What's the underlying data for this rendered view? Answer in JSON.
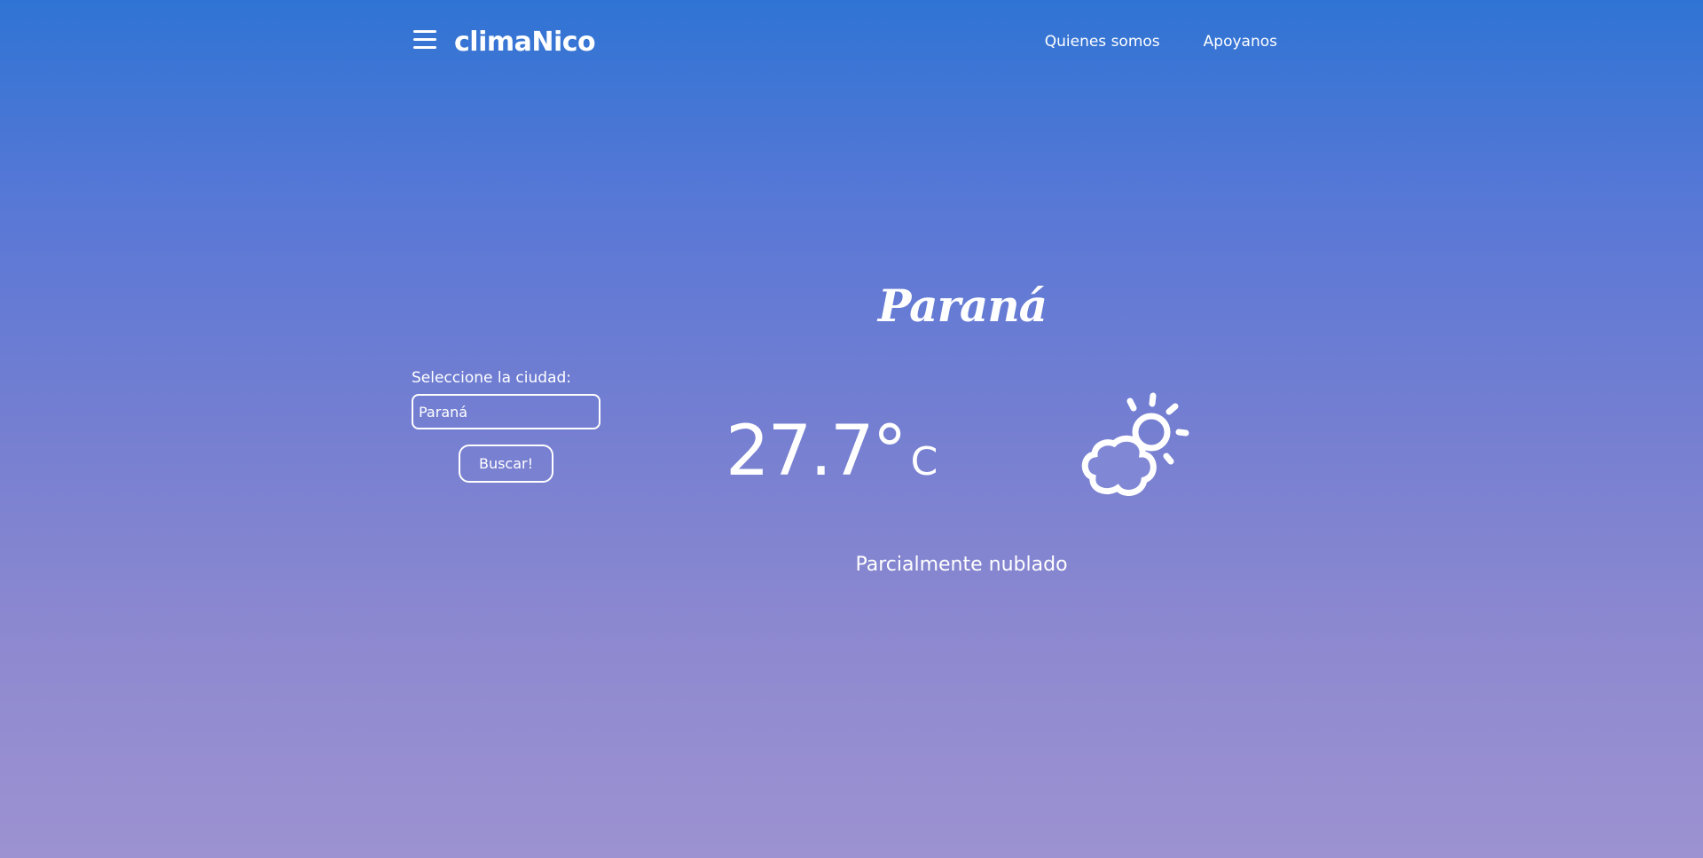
{
  "app": {
    "brand": "climaNico",
    "nav": [
      {
        "label": "Quienes somos"
      },
      {
        "label": "Apoyanos"
      }
    ],
    "menu_icon": "hamburger-icon"
  },
  "search": {
    "label": "Seleccione la ciudad:",
    "value": "Paraná",
    "button_label": "Buscar!"
  },
  "weather": {
    "city": "Paraná",
    "temperature": "27.7°",
    "unit": "C",
    "condition": "Parcialmente nublado",
    "icon": "partly-cloudy-icon"
  },
  "colors": {
    "gradient_top": "#2f74d4",
    "gradient_bottom": "#9c92d1",
    "text": "#ffffff"
  }
}
